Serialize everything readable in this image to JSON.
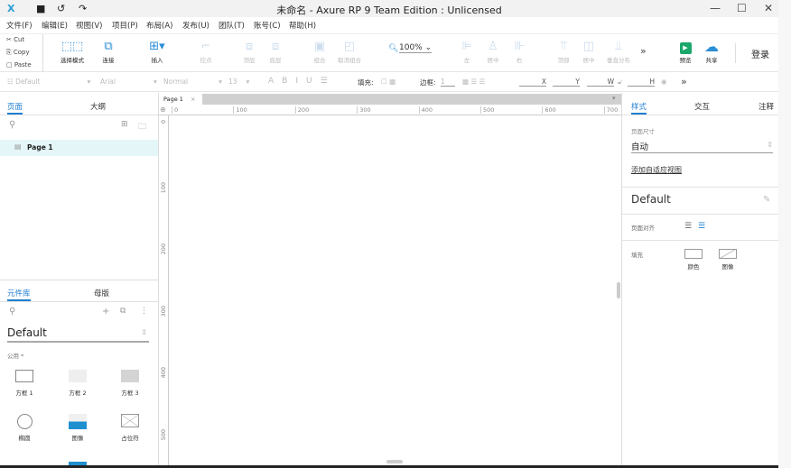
{
  "titlebar": {
    "title": "未命名 - Axure RP 9 Team Edition : Unlicensed"
  },
  "menu": [
    "文件(F)",
    "编辑(E)",
    "视图(V)",
    "项目(P)",
    "布局(A)",
    "发布(U)",
    "团队(T)",
    "账号(C)",
    "帮助(H)"
  ],
  "clipboard": {
    "cut": "Cut",
    "copy": "Copy",
    "paste": "Paste"
  },
  "toolbar": {
    "select_mode": "选择模式",
    "connect": "连接",
    "insert": "插入",
    "point": "控点",
    "top": "顶层",
    "bottom": "底层",
    "group": "组合",
    "ungroup": "取消组合",
    "zoom": "100%",
    "left": "左",
    "center": "居中",
    "right": "右",
    "top_align": "顶部",
    "middle": "居中",
    "distribute": "垂直分布",
    "preview": "预览",
    "share": "共享",
    "login": "登录"
  },
  "format": {
    "style": "Default",
    "font": "Arial",
    "weight": "Normal",
    "size": "13",
    "fill": "填充:",
    "border": "边框:",
    "border_val": "1",
    "x": "X",
    "y": "Y",
    "w": "W",
    "h": "H"
  },
  "pages": {
    "tabs": [
      "页面",
      "大纲"
    ],
    "items": [
      "Page 1"
    ]
  },
  "library": {
    "tabs": [
      "元件库",
      "母版"
    ],
    "selected": "Default",
    "category": "公用 *",
    "items": [
      "方框 1",
      "方框 2",
      "方框 3",
      "椭圆",
      "图像",
      "占位符"
    ]
  },
  "canvas": {
    "tab": "Page 1",
    "h_ticks": [
      "0",
      "100",
      "200",
      "300",
      "400",
      "500",
      "600",
      "700"
    ],
    "v_ticks": [
      "0",
      "100",
      "200",
      "300",
      "400",
      "500"
    ]
  },
  "inspector": {
    "tabs": [
      "样式",
      "交互",
      "注释"
    ],
    "page_size_label": "页面尺寸",
    "page_size": "自动",
    "adaptive_link": "添加自适应视图",
    "style_name": "Default",
    "align_label": "页面对齐",
    "fill_label": "填充",
    "fill_color": "颜色",
    "fill_image": "图像"
  },
  "colors": {
    "accent": "#1f7fd0",
    "preview": "#1aa86b",
    "share": "#2b8ed6"
  }
}
